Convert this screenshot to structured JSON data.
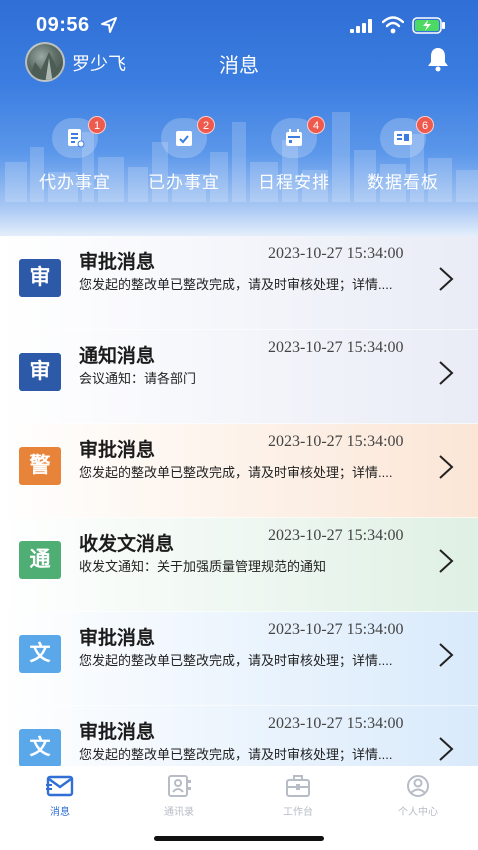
{
  "status_bar": {
    "time": "09:56"
  },
  "nav": {
    "user_name": "罗少飞",
    "title": "消息"
  },
  "quick_actions": [
    {
      "label": "代办事宜",
      "badge": "1",
      "icon": "document-icon"
    },
    {
      "label": "已办事宜",
      "badge": "2",
      "icon": "checked-calendar-icon"
    },
    {
      "label": "日程安排",
      "badge": "4",
      "icon": "calendar-icon"
    },
    {
      "label": "数据看板",
      "badge": "6",
      "icon": "dashboard-icon"
    }
  ],
  "messages": [
    {
      "badge": "审",
      "badge_color": "#2c59a8",
      "title": "审批消息",
      "time": "2023-10-27 15:34:00",
      "body": "您发起的整改单已整改完成，请及时审核处理；详情....",
      "bg": "#eef0f7"
    },
    {
      "badge": "审",
      "badge_color": "#2c59a8",
      "title": "通知消息",
      "time": "2023-10-27 15:34:00",
      "body": "会议通知：请各部门",
      "bg": "#eef0f7"
    },
    {
      "badge": "警",
      "badge_color": "#e8833a",
      "title": "审批消息",
      "time": "2023-10-27 15:34:00",
      "body": "您发起的整改单已整改完成，请及时审核处理；详情....",
      "bg": "#fbeadf"
    },
    {
      "badge": "通",
      "badge_color": "#4fae74",
      "title": "收发文消息",
      "time": "2023-10-27 15:34:00",
      "body": "收发文通知：关于加强质量管理规范的通知",
      "bg": "#e6f3ea"
    },
    {
      "badge": "文",
      "badge_color": "#5aa8ea",
      "title": "审批消息",
      "time": "2023-10-27 15:34:00",
      "body": "您发起的整改单已整改完成，请及时审核处理；详情....",
      "bg": "#e2effb"
    },
    {
      "badge": "文",
      "badge_color": "#5aa8ea",
      "title": "审批消息",
      "time": "2023-10-27 15:34:00",
      "body": "您发起的整改单已整改完成，请及时审核处理；详情....",
      "bg": "#e2effb"
    }
  ],
  "tabbar": [
    {
      "label": "消息",
      "icon": "mail-icon",
      "active": true
    },
    {
      "label": "通讯录",
      "icon": "contacts-icon",
      "active": false
    },
    {
      "label": "工作台",
      "icon": "briefcase-icon",
      "active": false
    },
    {
      "label": "个人中心",
      "icon": "profile-icon",
      "active": false
    }
  ],
  "colors": {
    "accent": "#2f6fd6",
    "badge_red": "#ef5a4f",
    "inactive_tab": "#b7bcc6"
  }
}
